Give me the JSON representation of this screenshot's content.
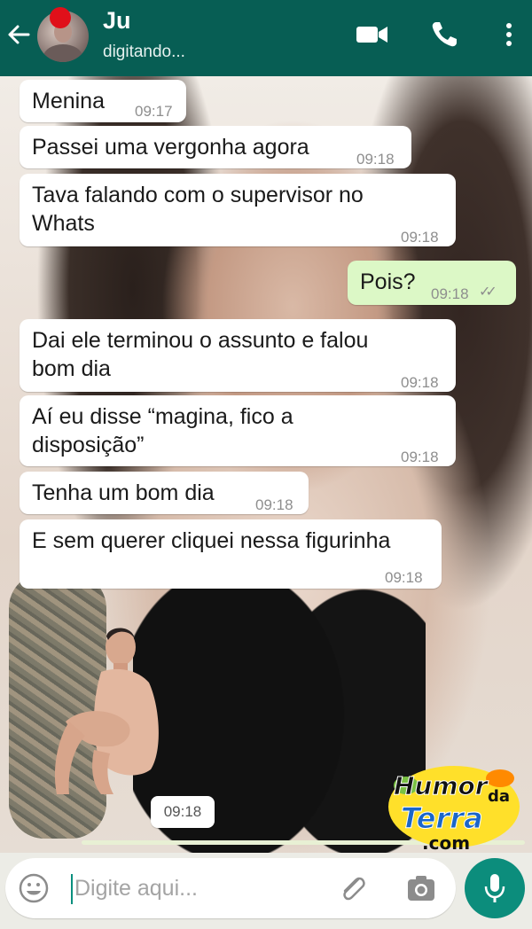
{
  "header": {
    "contact_name": "Ju",
    "status": "digitando...",
    "colors": {
      "bar": "#075e54"
    },
    "icons": [
      "back-arrow-icon",
      "video-call-icon",
      "phone-call-icon",
      "more-options-icon"
    ]
  },
  "messages": [
    {
      "direction": "in",
      "lines": [
        "Menina"
      ],
      "time": "09:17"
    },
    {
      "direction": "in",
      "lines": [
        "Passei uma vergonha agora"
      ],
      "time": "09:18"
    },
    {
      "direction": "in",
      "lines": [
        "Tava falando com o supervisor no",
        "Whats"
      ],
      "time": "09:18"
    },
    {
      "direction": "out",
      "lines": [
        "Pois?"
      ],
      "time": "09:18",
      "ticks": "✓✓"
    },
    {
      "direction": "in",
      "lines": [
        "Dai ele terminou o assunto e falou",
        "bom dia"
      ],
      "time": "09:18"
    },
    {
      "direction": "in",
      "lines": [
        "Aí eu disse “magina, fico a",
        "disposição”"
      ],
      "time": "09:18"
    },
    {
      "direction": "in",
      "lines": [
        "Tenha um bom dia"
      ],
      "time": "09:18"
    },
    {
      "direction": "in",
      "lines": [
        "E sem querer cliquei nessa figurinha"
      ],
      "time": "09:18"
    }
  ],
  "sticker": {
    "time": "09:18"
  },
  "watermark": {
    "text_lines": [
      "Humor",
      "da",
      "Terra",
      ".com"
    ]
  },
  "input": {
    "placeholder": "Digite aqui..."
  },
  "colors": {
    "outgoing_bubble": "#dcf8c6",
    "incoming_bubble": "#ffffff",
    "mic_button": "#0c8d7c"
  }
}
